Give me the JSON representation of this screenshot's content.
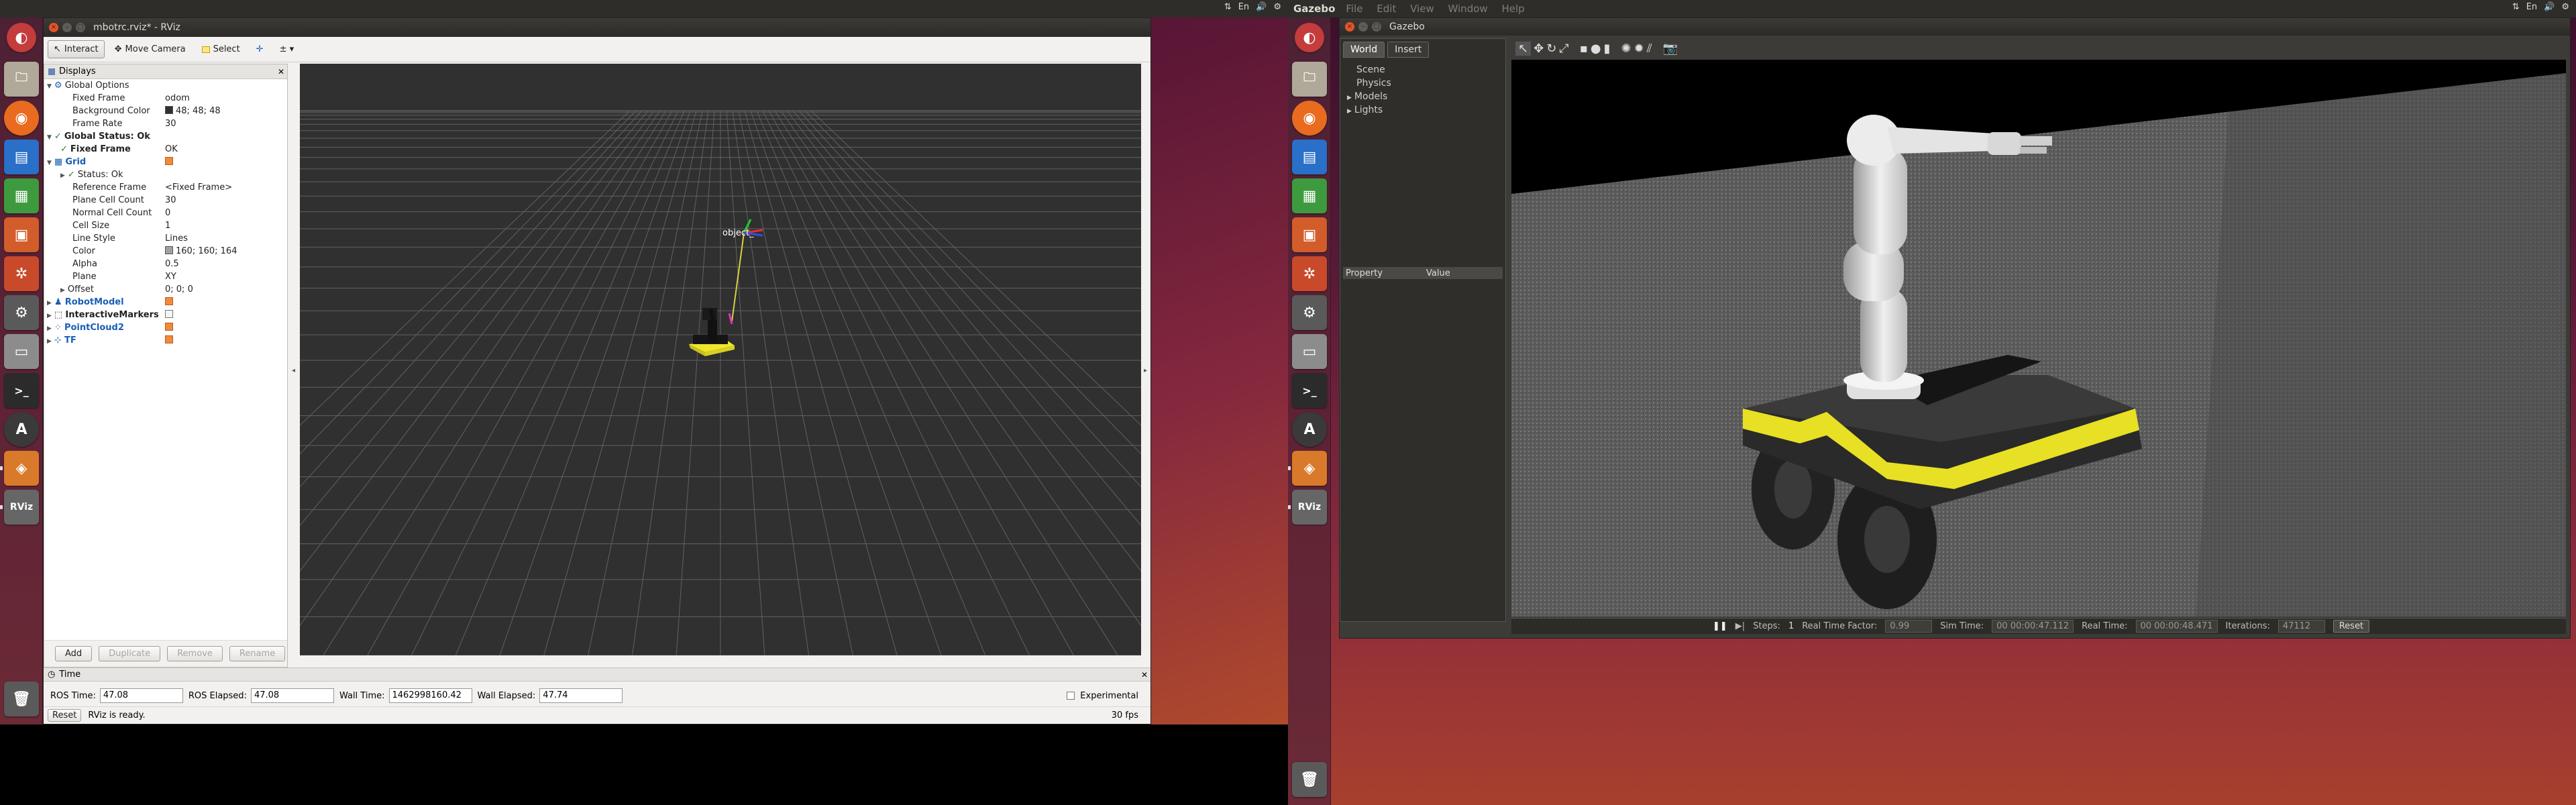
{
  "left_screen": {
    "rviz": {
      "window_title": "mbotrc.rviz* - RViz",
      "toolbar": {
        "interact": "Interact",
        "move_camera": "Move Camera",
        "select": "Select"
      },
      "displays": {
        "title": "Displays",
        "rows": [
          {
            "indent": 1,
            "label": "Global Options",
            "value": ""
          },
          {
            "indent": 2,
            "label": "Fixed Frame",
            "value": "odom"
          },
          {
            "indent": 2,
            "label": "Background Color",
            "value": "48; 48; 48"
          },
          {
            "indent": 2,
            "label": "Frame Rate",
            "value": "30"
          },
          {
            "indent": 1,
            "label": "Global Status: Ok",
            "value": ""
          },
          {
            "indent": 2,
            "label": "Fixed Frame",
            "value": "OK"
          },
          {
            "indent": 1,
            "label": "Grid",
            "value": ""
          },
          {
            "indent": 2,
            "label": "Status: Ok",
            "value": ""
          },
          {
            "indent": 2,
            "label": "Reference Frame",
            "value": "<Fixed Frame>"
          },
          {
            "indent": 2,
            "label": "Plane Cell Count",
            "value": "30"
          },
          {
            "indent": 2,
            "label": "Normal Cell Count",
            "value": "0"
          },
          {
            "indent": 2,
            "label": "Cell Size",
            "value": "1"
          },
          {
            "indent": 2,
            "label": "Line Style",
            "value": "Lines"
          },
          {
            "indent": 2,
            "label": "Color",
            "value": "160; 160; 164"
          },
          {
            "indent": 2,
            "label": "Alpha",
            "value": "0.5"
          },
          {
            "indent": 2,
            "label": "Plane",
            "value": "XY"
          },
          {
            "indent": 2,
            "label": "Offset",
            "value": "0; 0; 0"
          },
          {
            "indent": 1,
            "label": "RobotModel",
            "value": ""
          },
          {
            "indent": 1,
            "label": "InteractiveMarkers",
            "value": ""
          },
          {
            "indent": 1,
            "label": "PointCloud2",
            "value": ""
          },
          {
            "indent": 1,
            "label": "TF",
            "value": ""
          }
        ],
        "buttons": {
          "add": "Add",
          "duplicate": "Duplicate",
          "remove": "Remove",
          "rename": "Rename"
        }
      },
      "viewport": {
        "marker_label": "object_"
      },
      "time": {
        "title": "Time",
        "ros_time_label": "ROS Time:",
        "ros_time": "47.08",
        "ros_elapsed_label": "ROS Elapsed:",
        "ros_elapsed": "47.08",
        "wall_time_label": "Wall Time:",
        "wall_time": "1462998160.42",
        "wall_elapsed_label": "Wall Elapsed:",
        "wall_elapsed": "47.74",
        "experimental": "Experimental"
      },
      "status": {
        "reset": "Reset",
        "message": "RViz is ready.",
        "fps": "30 fps"
      }
    }
  },
  "right_screen": {
    "topbar": {
      "app_name": "Gazebo",
      "menus": [
        "File",
        "Edit",
        "View",
        "Window",
        "Help"
      ],
      "keyboard": "En"
    },
    "gazebo": {
      "window_title": "Gazebo",
      "tabs": {
        "world": "World",
        "insert": "Insert"
      },
      "tree": [
        "Scene",
        "Physics",
        "Models",
        "Lights"
      ],
      "property_header": "Property",
      "value_header": "Value",
      "bottom": {
        "steps_label": "Steps:",
        "steps_value": "1",
        "rtf_label": "Real Time Factor:",
        "rtf_value": "0.99",
        "sim_time_label": "Sim Time:",
        "sim_time_value": "00 00:00:47.112",
        "real_time_label": "Real Time:",
        "real_time_value": "00 00:00:48.471",
        "iterations_label": "Iterations:",
        "iterations_value": "47112",
        "reset": "Reset"
      }
    }
  },
  "left_topbar": {
    "keyboard": "En"
  },
  "colors": {
    "launcher": "#5c2235",
    "rviz_bg": "#303030",
    "grid": "#a0a0a4",
    "robot_yellow": "#e6e02a"
  }
}
